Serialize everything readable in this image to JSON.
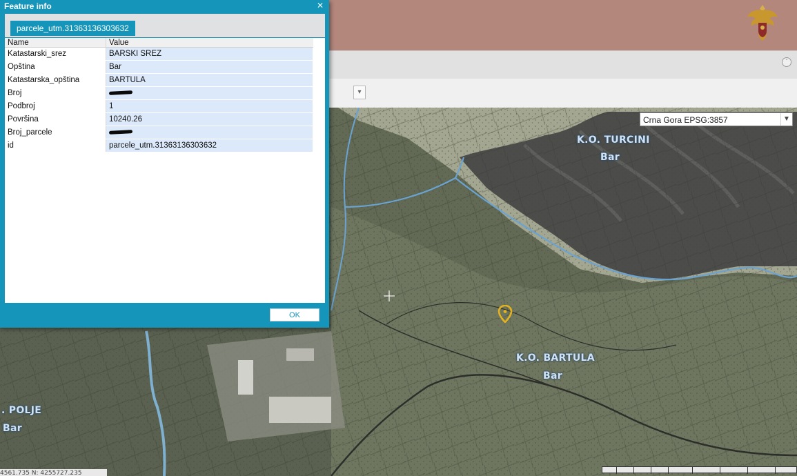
{
  "dialog": {
    "title": "Feature info",
    "close_icon": "close-icon",
    "tab_label": "parcele_utm.31363136303632",
    "columns": {
      "name": "Name",
      "value": "Value"
    },
    "rows": [
      {
        "name": "Katastarski_srez",
        "value": "BARSKI SREZ"
      },
      {
        "name": "Opština",
        "value": "Bar"
      },
      {
        "name": "Katastarska_opština",
        "value": "BARTULA"
      },
      {
        "name": "Broj",
        "value": "",
        "redacted": true
      },
      {
        "name": "Podbroj",
        "value": "1"
      },
      {
        "name": "Površina",
        "value": "10240.26"
      },
      {
        "name": "Broj_parcele",
        "value": "",
        "redacted": true
      },
      {
        "name": "id",
        "value": "parcele_utm.31363136303632"
      }
    ],
    "ok_label": "OK"
  },
  "map": {
    "crs_selected": "Crna Gora EPSG:3857",
    "labels": {
      "turcini_name": "K.O. TURCINI",
      "turcini_municipality": "Bar",
      "bartula_name": "K.O. BARTULA",
      "bartula_municipality": "Bar",
      "polje_name": ". POLJE",
      "polje_municipality": "Bar"
    },
    "coordinate_readout": "4561.735    N: 4255727.235",
    "icons": {
      "pin": "map-pin-icon",
      "crosshair": "crosshair-icon",
      "emblem": "coat-of-arms-icon"
    }
  },
  "colors": {
    "dialog_accent": "#1495b9",
    "header_band": "#b4877d",
    "value_cell_bg": "#dce9fa",
    "boundary_line": "#6aa3d2",
    "label_text": "#cfe3f4"
  }
}
